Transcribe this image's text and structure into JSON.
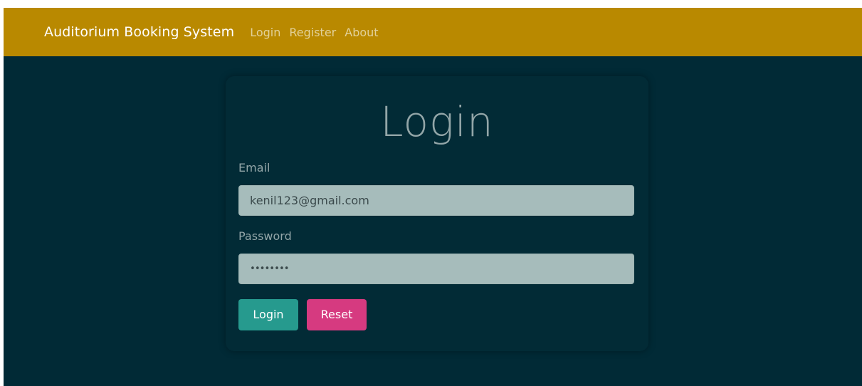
{
  "navbar": {
    "brand": "Auditorium Booking System",
    "links": [
      "Login",
      "Register",
      "About"
    ]
  },
  "form": {
    "title": "Login",
    "email_label": "Email",
    "email_value": "kenil123@gmail.com",
    "password_label": "Password",
    "password_value": "••••••••",
    "login_button": "Login",
    "reset_button": "Reset"
  },
  "colors": {
    "navbar_bg": "#b98900",
    "page_bg": "#012a36",
    "input_bg": "#a6bcbb",
    "login_button": "#269a8e",
    "reset_button": "#d63a80"
  }
}
